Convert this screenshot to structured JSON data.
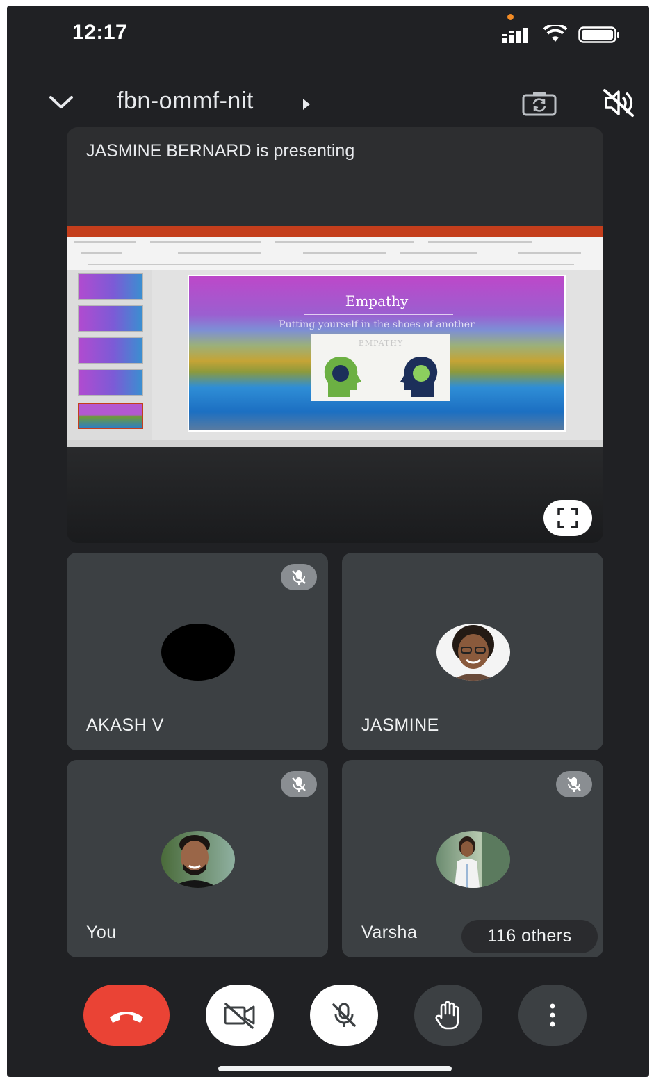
{
  "status_bar": {
    "time": "12:17",
    "signal_icon": "cellular-signal-icon",
    "wifi_icon": "wifi-icon",
    "battery_icon": "battery-icon",
    "privacy_indicator_color": "#f28b25"
  },
  "top_bar": {
    "meeting_code": "fbn-ommf-nit",
    "collapse_icon": "chevron-down-icon",
    "details_icon": "play-arrow-icon",
    "switch_camera_icon": "flip-camera-icon",
    "audio_icon": "speaker-off-icon"
  },
  "presentation": {
    "label": "JASMINE BERNARD is presenting",
    "slide": {
      "title": "Empathy",
      "subtitle": "Putting yourself in the shoes of another",
      "card_label": "EMPATHY"
    },
    "fullscreen_icon": "fullscreen-icon"
  },
  "participants": [
    {
      "name": "AKASH V",
      "muted": true,
      "avatar": "black-circle"
    },
    {
      "name": "JASMINE",
      "muted": false,
      "avatar": "photo"
    },
    {
      "name": "You",
      "muted": true,
      "avatar": "photo"
    },
    {
      "name": "Varsha",
      "muted": true,
      "avatar": "photo"
    }
  ],
  "others_count_label": "116 others",
  "controls": [
    {
      "name": "end-call",
      "icon": "phone-hangup-icon",
      "color": "#ea4335"
    },
    {
      "name": "camera",
      "icon": "videocam-off-icon",
      "state": "off"
    },
    {
      "name": "microphone",
      "icon": "mic-off-icon",
      "state": "off"
    },
    {
      "name": "raise-hand",
      "icon": "hand-icon"
    },
    {
      "name": "more-options",
      "icon": "more-vert-icon"
    }
  ],
  "colors": {
    "background": "#202124",
    "tile": "#3c4043",
    "end_call": "#ea4335",
    "mute_badge": "#8a8e92"
  }
}
